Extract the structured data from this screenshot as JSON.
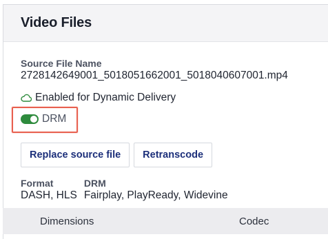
{
  "panel": {
    "title": "Video Files"
  },
  "source_file": {
    "label": "Source File Name",
    "value": "2728142649001_5018051662001_5018040607001.mp4"
  },
  "delivery": {
    "icon": "cloud-icon",
    "text": "Enabled for Dynamic Delivery"
  },
  "drm_toggle": {
    "label": "DRM",
    "state": "on",
    "color": "#2e8b3d"
  },
  "actions": {
    "replace_label": "Replace source file",
    "retranscode_label": "Retranscode"
  },
  "format": {
    "label": "Format",
    "value": "DASH, HLS"
  },
  "drm": {
    "label": "DRM",
    "value": "Fairplay, PlayReady, Widevine"
  },
  "table": {
    "columns": [
      "Dimensions",
      "Codec"
    ]
  },
  "colors": {
    "highlight": "#e8604f",
    "button_text": "#1c2f7a"
  }
}
